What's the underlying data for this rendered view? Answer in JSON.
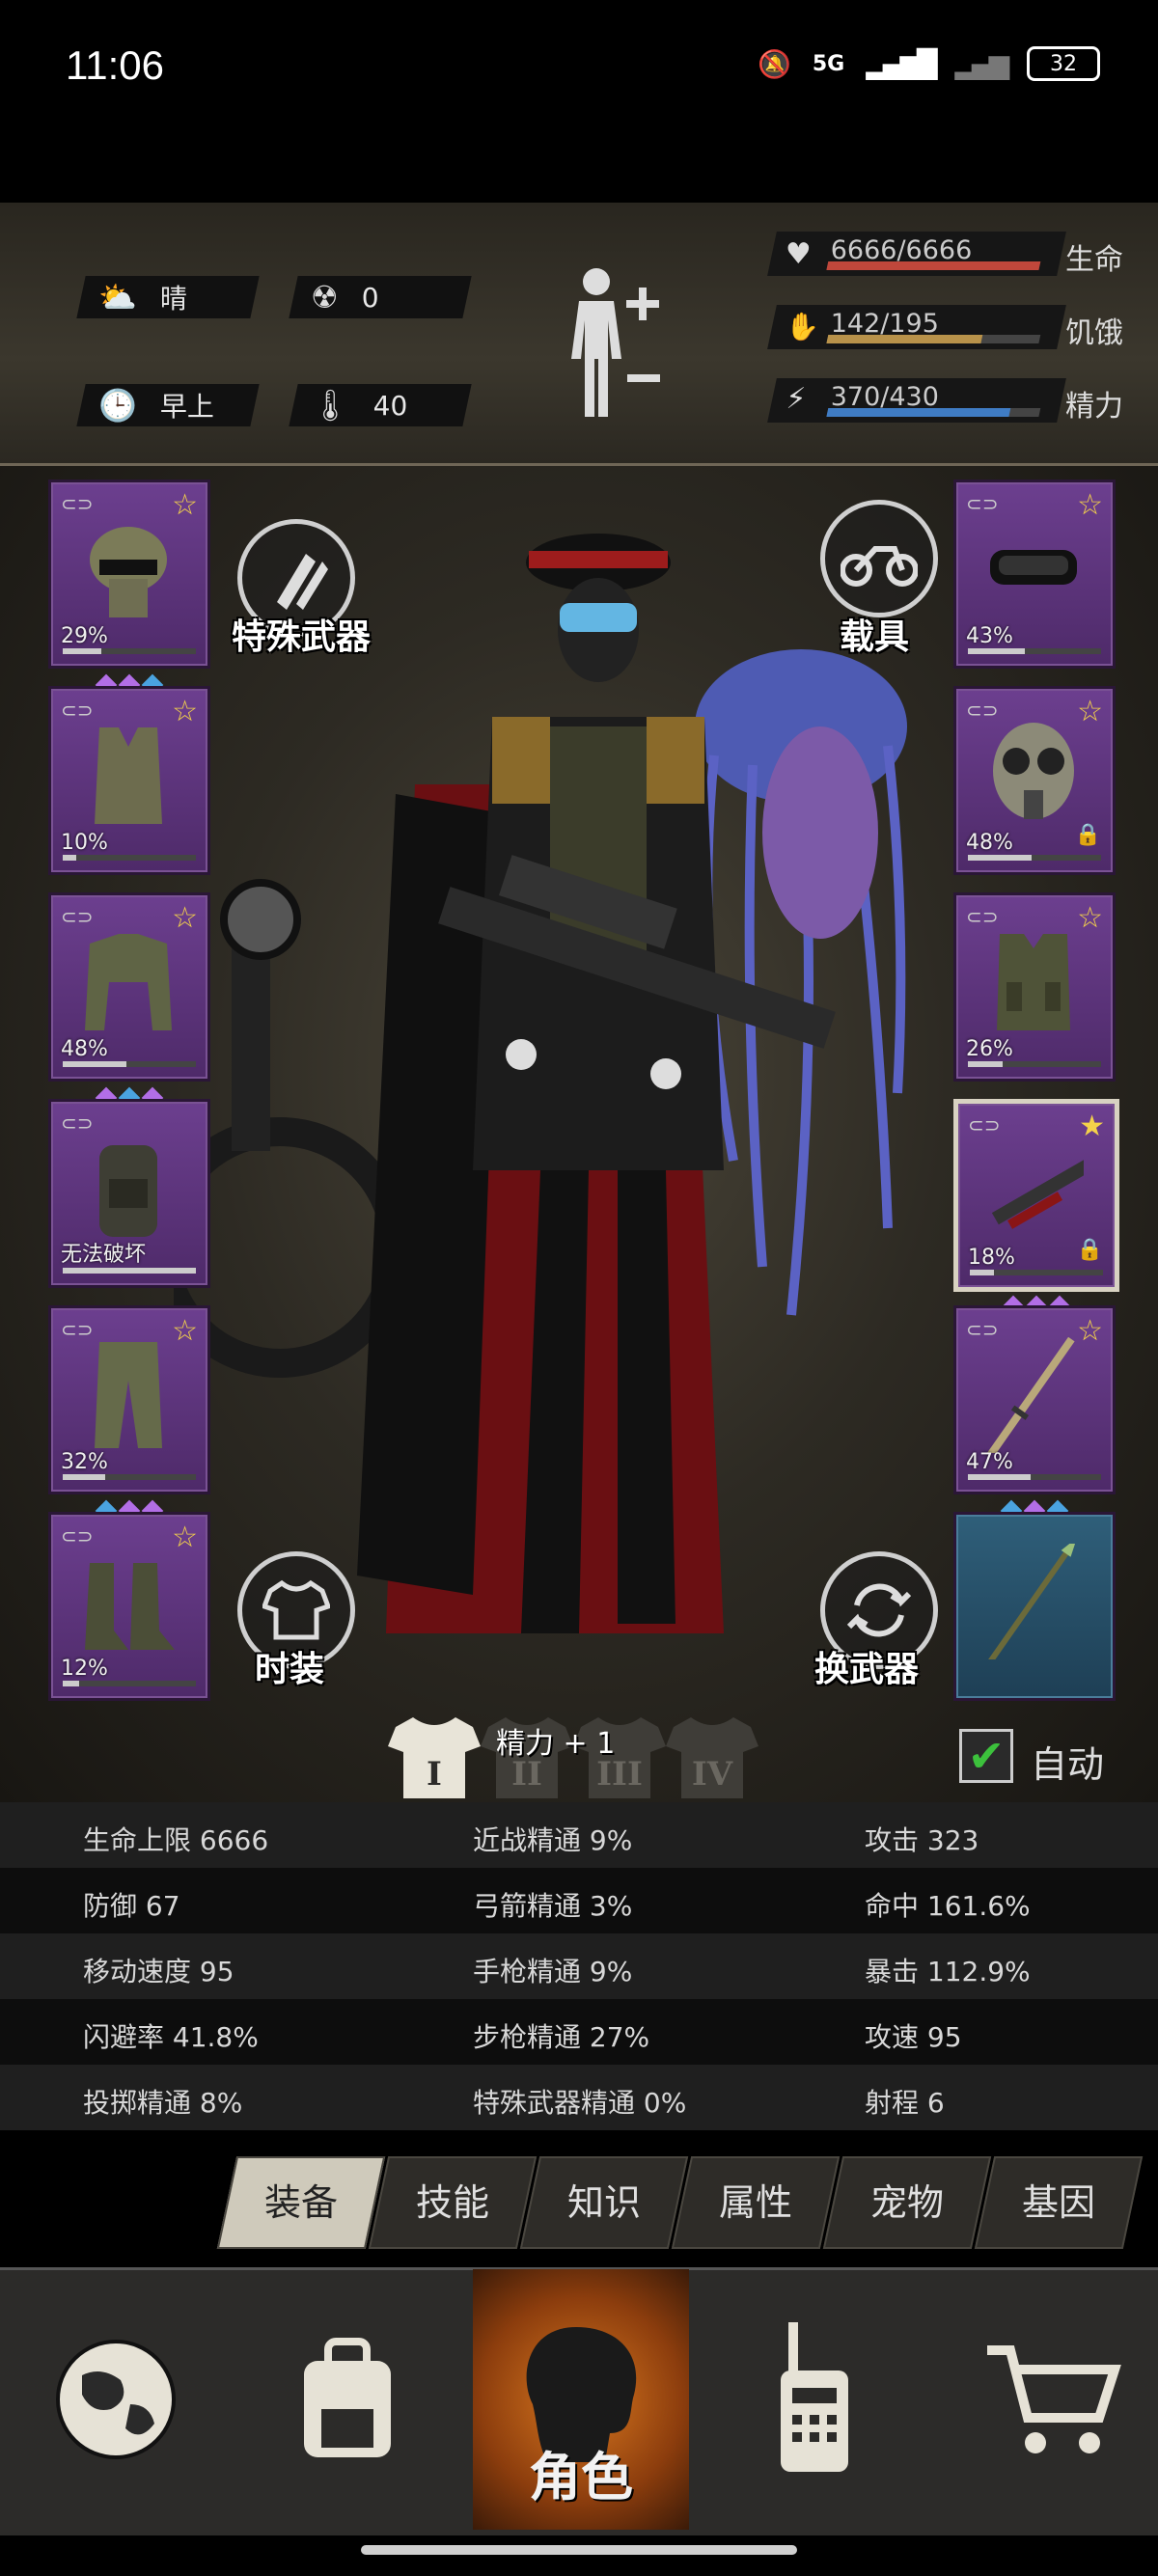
{
  "status_bar": {
    "time": "11:06",
    "network": "5G",
    "battery": "32"
  },
  "hud": {
    "weather": "晴",
    "radiation": "0",
    "time_of_day": "早上",
    "temperature": "40",
    "health": {
      "text": "6666/6666",
      "label": "生命",
      "fraction": 1.0,
      "color": "#c0473b"
    },
    "hunger": {
      "text": "142/195",
      "label": "饥饿",
      "fraction": 0.728,
      "color": "#b8924a"
    },
    "energy": {
      "text": "370/430",
      "label": "精力",
      "fraction": 0.86,
      "color": "#3f7cc4"
    }
  },
  "left_slots": [
    {
      "name": "helmet",
      "pct": "29%",
      "durability": 0.29,
      "gems": [
        "#b26ee6",
        "#b26ee6",
        "#4aa3e0"
      ]
    },
    {
      "name": "vest",
      "pct": "10%",
      "durability": 0.1,
      "gems": []
    },
    {
      "name": "jacket",
      "pct": "48%",
      "durability": 0.48,
      "gems": [
        "#b26ee6",
        "#4aa3e0",
        "#b26ee6"
      ]
    },
    {
      "name": "backpack",
      "pct": "无法破坏",
      "durability": 1.0,
      "gems": []
    },
    {
      "name": "pants",
      "pct": "32%",
      "durability": 0.32,
      "gems": [
        "#4aa3e0",
        "#b26ee6",
        "#b26ee6"
      ]
    },
    {
      "name": "boots",
      "pct": "12%",
      "durability": 0.12,
      "gems": []
    }
  ],
  "right_slots": [
    {
      "name": "goggles",
      "pct": "43%",
      "durability": 0.43,
      "gems": []
    },
    {
      "name": "gas-mask",
      "pct": "48%",
      "durability": 0.48,
      "gems": []
    },
    {
      "name": "armor-vest",
      "pct": "26%",
      "durability": 0.26,
      "gems": []
    },
    {
      "name": "rifle",
      "pct": "18%",
      "durability": 0.18,
      "gems": [
        "#b26ee6",
        "#b26ee6",
        "#b26ee6"
      ]
    },
    {
      "name": "katana",
      "pct": "47%",
      "durability": 0.47,
      "gems": [
        "#4aa3e0",
        "#b26ee6",
        "#4aa3e0"
      ]
    },
    {
      "name": "spear",
      "pct": "",
      "durability": 0,
      "gems": []
    }
  ],
  "buttons": {
    "special_weapon": "特殊武器",
    "vehicle": "载具",
    "fashion": "时装",
    "switch_weapon": "换武器",
    "auto": "自动"
  },
  "outfits": {
    "sets": [
      "I",
      "II",
      "III",
      "IV"
    ],
    "bonus": "精力 + 1"
  },
  "stats": [
    [
      "生命上限 6666",
      "近战精通 9%",
      "攻击 323"
    ],
    [
      "防御 67",
      "弓箭精通 3%",
      "命中 161.6%"
    ],
    [
      "移动速度 95",
      "手枪精通 9%",
      "暴击 112.9%"
    ],
    [
      "闪避率 41.8%",
      "步枪精通 27%",
      "攻速 95"
    ],
    [
      "投掷精通 8%",
      "特殊武器精通 0%",
      "射程 6"
    ]
  ],
  "tabs": [
    "装备",
    "技能",
    "知识",
    "属性",
    "宠物",
    "基因"
  ],
  "bottom_nav": {
    "character_label": "角色"
  }
}
